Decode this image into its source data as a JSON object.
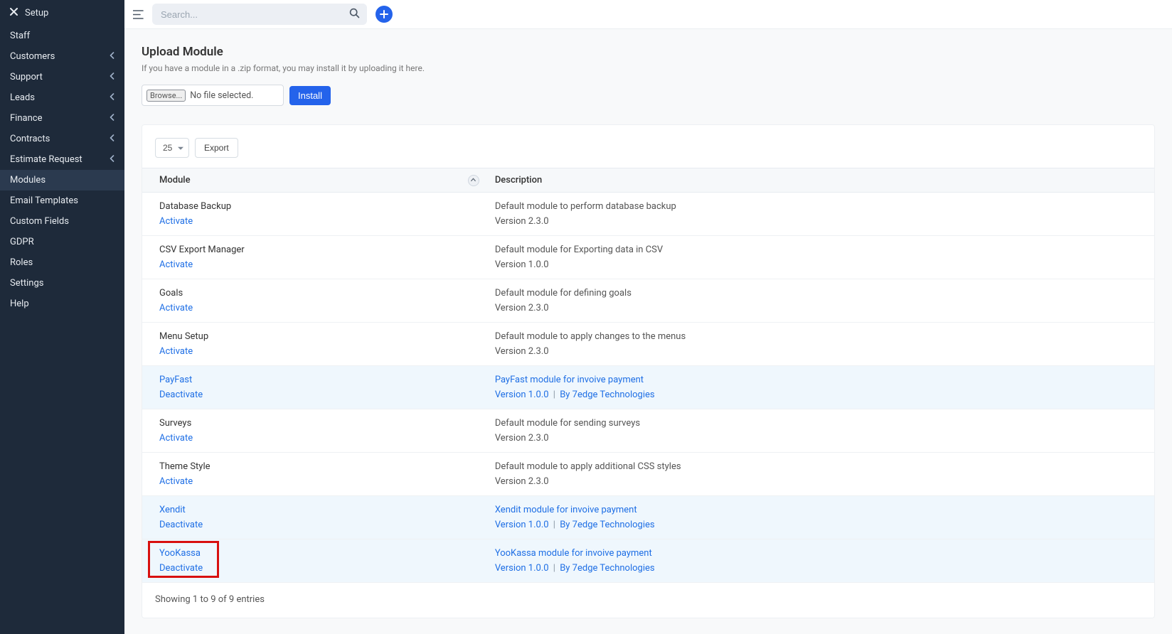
{
  "sidebar": {
    "title": "Setup",
    "items": [
      {
        "label": "Staff",
        "expandable": false
      },
      {
        "label": "Customers",
        "expandable": true
      },
      {
        "label": "Support",
        "expandable": true
      },
      {
        "label": "Leads",
        "expandable": true
      },
      {
        "label": "Finance",
        "expandable": true
      },
      {
        "label": "Contracts",
        "expandable": true
      },
      {
        "label": "Estimate Request",
        "expandable": true
      },
      {
        "label": "Modules",
        "expandable": false,
        "active": true
      },
      {
        "label": "Email Templates",
        "expandable": false
      },
      {
        "label": "Custom Fields",
        "expandable": false
      },
      {
        "label": "GDPR",
        "expandable": false
      },
      {
        "label": "Roles",
        "expandable": false
      },
      {
        "label": "Settings",
        "expandable": false
      },
      {
        "label": "Help",
        "expandable": false
      }
    ]
  },
  "topbar": {
    "search_placeholder": "Search..."
  },
  "upload": {
    "title": "Upload Module",
    "description": "If you have a module in a .zip format, you may install it by uploading it here.",
    "browse_label": "Browse...",
    "file_status": "No file selected.",
    "install_label": "Install"
  },
  "table": {
    "page_size": "25",
    "export_label": "Export",
    "headers": {
      "module": "Module",
      "description": "Description"
    },
    "rows": [
      {
        "name": "Database Backup",
        "action": "Activate",
        "desc": "Default module to perform database backup",
        "version": "Version 2.3.0",
        "active": false,
        "by": ""
      },
      {
        "name": "CSV Export Manager",
        "action": "Activate",
        "desc": "Default module for Exporting data in CSV",
        "version": "Version 1.0.0",
        "active": false,
        "by": ""
      },
      {
        "name": "Goals",
        "action": "Activate",
        "desc": "Default module for defining goals",
        "version": "Version 2.3.0",
        "active": false,
        "by": ""
      },
      {
        "name": "Menu Setup",
        "action": "Activate",
        "desc": "Default module to apply changes to the menus",
        "version": "Version 2.3.0",
        "active": false,
        "by": ""
      },
      {
        "name": "PayFast",
        "action": "Deactivate",
        "desc": "PayFast module for invoive payment",
        "version": "Version 1.0.0",
        "active": true,
        "by": "By 7edge Technologies"
      },
      {
        "name": "Surveys",
        "action": "Activate",
        "desc": "Default module for sending surveys",
        "version": "Version 2.3.0",
        "active": false,
        "by": ""
      },
      {
        "name": "Theme Style",
        "action": "Activate",
        "desc": "Default module to apply additional CSS styles",
        "version": "Version 2.3.0",
        "active": false,
        "by": ""
      },
      {
        "name": "Xendit",
        "action": "Deactivate",
        "desc": "Xendit module for invoive payment",
        "version": "Version 1.0.0",
        "active": true,
        "by": "By 7edge Technologies"
      },
      {
        "name": "YooKassa",
        "action": "Deactivate",
        "desc": "YooKassa module for invoive payment",
        "version": "Version 1.0.0",
        "active": true,
        "by": "By 7edge Technologies",
        "highlighted": true
      }
    ],
    "footer": "Showing 1 to 9 of 9 entries"
  }
}
